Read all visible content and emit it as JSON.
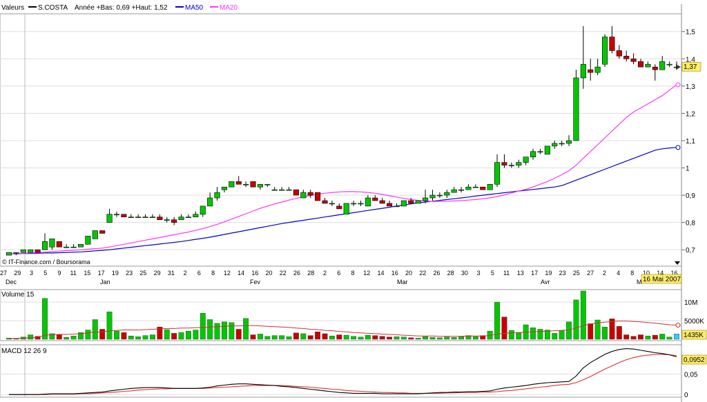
{
  "header": {
    "label_valeurs": "Valeurs",
    "ticker": "S.COSTA",
    "year_range": "Année +Bas: 0,69 +Haut: 1,52",
    "ma50_label": "MA50",
    "ma20_label": "MA20"
  },
  "colors": {
    "up": "#00c800",
    "down": "#c80000",
    "ma50": "#0000cc",
    "ma20": "#ff33ff",
    "volume_avg": "#cc3333",
    "macd": "#000000",
    "signal": "#dd3333",
    "label_bg": "#ffee66",
    "volume_last": "#33ccff"
  },
  "price_panel": {
    "y_ticks": [
      "1,5",
      "1,4",
      "1,3",
      "1,2",
      "1,1",
      "1",
      "0,9",
      "0,8",
      "0,7"
    ],
    "y_tick_values": [
      1.5,
      1.4,
      1.3,
      1.2,
      1.1,
      1.0,
      0.9,
      0.8,
      0.7
    ],
    "ylim": [
      0.66,
      1.56
    ],
    "last_price_label": "1,37",
    "last_price": 1.37,
    "date_tooltip": "16 Mai 2007",
    "credit": "© IT-Finance.com / Boursorama"
  },
  "x_axis": {
    "day_labels": [
      "27",
      "29",
      "3",
      "5",
      "9",
      "11",
      "15",
      "17",
      "19",
      "23",
      "25",
      "29",
      "31",
      "2",
      "6",
      "8",
      "12",
      "14",
      "16",
      "20",
      "22",
      "26",
      "28",
      "2",
      "6",
      "8",
      "12",
      "14",
      "16",
      "20",
      "22",
      "26",
      "28",
      "30",
      "3",
      "5",
      "11",
      "13",
      "17",
      "19",
      "23",
      "25",
      "27",
      "2",
      "4",
      "8",
      "10",
      "14",
      "16"
    ],
    "month_labels": [
      "Dec",
      "Jan",
      "Fev",
      "Mar",
      "Avr",
      "M"
    ],
    "month_label_days": [
      0,
      14,
      46,
      90,
      120,
      154
    ]
  },
  "volume_panel": {
    "title": "Volume 15",
    "y_ticks": [
      "10M",
      "5000K"
    ],
    "y_tick_values": [
      10000000,
      5000000
    ],
    "ymax": 13000000,
    "last_label": "1435K"
  },
  "macd_panel": {
    "title": "MACD 12 26 9",
    "y_ticks": [
      "0,05",
      "0"
    ],
    "y_tick_values": [
      0.05,
      0
    ],
    "ylim": [
      -0.003,
      0.118
    ],
    "last_label": "0,0952"
  },
  "chart_data": {
    "type": "candlestick",
    "title": "S.COSTA",
    "candles": [
      [
        0.68,
        0.69,
        0.68,
        0.69,
        300000
      ],
      [
        0.69,
        0.69,
        0.68,
        0.69,
        200000
      ],
      [
        0.69,
        0.7,
        0.69,
        0.7,
        600000
      ],
      [
        0.69,
        0.7,
        0.69,
        0.7,
        1200000
      ],
      [
        0.7,
        0.7,
        0.69,
        0.69,
        800000
      ],
      [
        0.7,
        0.76,
        0.7,
        0.73,
        11000000
      ],
      [
        0.71,
        0.74,
        0.7,
        0.74,
        1500000
      ],
      [
        0.73,
        0.73,
        0.71,
        0.71,
        1300000
      ],
      [
        0.71,
        0.72,
        0.71,
        0.71,
        500000
      ],
      [
        0.71,
        0.72,
        0.71,
        0.71,
        900000
      ],
      [
        0.71,
        0.72,
        0.71,
        0.72,
        1800000
      ],
      [
        0.72,
        0.75,
        0.72,
        0.75,
        2500000
      ],
      [
        0.74,
        0.77,
        0.74,
        0.77,
        5300000
      ],
      [
        0.77,
        0.77,
        0.76,
        0.76,
        2700000
      ],
      [
        0.8,
        0.85,
        0.8,
        0.83,
        7400000
      ],
      [
        0.83,
        0.84,
        0.82,
        0.83,
        2200000
      ],
      [
        0.83,
        0.83,
        0.82,
        0.82,
        1800000
      ],
      [
        0.82,
        0.83,
        0.82,
        0.82,
        900000
      ],
      [
        0.82,
        0.83,
        0.82,
        0.82,
        700000
      ],
      [
        0.82,
        0.83,
        0.82,
        0.82,
        1000000
      ],
      [
        0.82,
        0.83,
        0.82,
        0.82,
        1200000
      ],
      [
        0.82,
        0.83,
        0.81,
        0.81,
        3300000
      ],
      [
        0.81,
        0.82,
        0.8,
        0.81,
        2600000
      ],
      [
        0.81,
        0.82,
        0.79,
        0.8,
        1600000
      ],
      [
        0.81,
        0.83,
        0.81,
        0.82,
        1800000
      ],
      [
        0.82,
        0.83,
        0.82,
        0.82,
        2200000
      ],
      [
        0.82,
        0.84,
        0.82,
        0.83,
        2500000
      ],
      [
        0.83,
        0.86,
        0.82,
        0.86,
        7000000
      ],
      [
        0.86,
        0.91,
        0.86,
        0.89,
        5300000
      ],
      [
        0.89,
        0.93,
        0.88,
        0.91,
        4300000
      ],
      [
        0.92,
        0.93,
        0.91,
        0.93,
        4700000
      ],
      [
        0.93,
        0.95,
        0.93,
        0.95,
        4500000
      ],
      [
        0.95,
        0.97,
        0.94,
        0.94,
        2700000
      ],
      [
        0.94,
        0.95,
        0.93,
        0.94,
        5600000
      ],
      [
        0.95,
        0.95,
        0.93,
        0.93,
        1200000
      ],
      [
        0.93,
        0.94,
        0.92,
        0.94,
        1400000
      ],
      [
        0.94,
        0.94,
        0.93,
        0.94,
        800000
      ],
      [
        0.92,
        0.93,
        0.92,
        0.92,
        1000000
      ],
      [
        0.92,
        0.93,
        0.92,
        0.92,
        1000000
      ],
      [
        0.92,
        0.93,
        0.92,
        0.92,
        700000
      ],
      [
        0.92,
        0.92,
        0.9,
        0.9,
        1700000
      ],
      [
        0.89,
        0.92,
        0.89,
        0.91,
        1500000
      ],
      [
        0.91,
        0.92,
        0.89,
        0.9,
        1000000
      ],
      [
        0.91,
        0.91,
        0.88,
        0.88,
        2000000
      ],
      [
        0.88,
        0.89,
        0.87,
        0.87,
        1500000
      ],
      [
        0.87,
        0.88,
        0.86,
        0.87,
        900000
      ],
      [
        0.86,
        0.87,
        0.85,
        0.85,
        1200000
      ],
      [
        0.83,
        0.87,
        0.83,
        0.87,
        1100000
      ],
      [
        0.87,
        0.88,
        0.86,
        0.87,
        800000
      ],
      [
        0.87,
        0.88,
        0.86,
        0.87,
        600000
      ],
      [
        0.86,
        0.9,
        0.86,
        0.89,
        1100000
      ],
      [
        0.89,
        0.9,
        0.88,
        0.88,
        1000000
      ],
      [
        0.88,
        0.89,
        0.87,
        0.87,
        800000
      ],
      [
        0.87,
        0.88,
        0.86,
        0.86,
        600000
      ],
      [
        0.86,
        0.87,
        0.86,
        0.86,
        700000
      ],
      [
        0.86,
        0.88,
        0.86,
        0.88,
        600000
      ],
      [
        0.88,
        0.89,
        0.87,
        0.87,
        400000
      ],
      [
        0.87,
        0.88,
        0.87,
        0.88,
        300000
      ],
      [
        0.88,
        0.92,
        0.87,
        0.89,
        700000
      ],
      [
        0.89,
        0.92,
        0.88,
        0.9,
        500000
      ],
      [
        0.9,
        0.91,
        0.89,
        0.9,
        400000
      ],
      [
        0.9,
        0.92,
        0.89,
        0.91,
        600000
      ],
      [
        0.91,
        0.93,
        0.91,
        0.92,
        500000
      ],
      [
        0.92,
        0.93,
        0.91,
        0.92,
        700000
      ],
      [
        0.92,
        0.94,
        0.92,
        0.93,
        1000000
      ],
      [
        0.93,
        0.94,
        0.93,
        0.93,
        700000
      ],
      [
        0.93,
        0.93,
        0.92,
        0.92,
        1000000
      ],
      [
        0.92,
        0.94,
        0.92,
        0.94,
        2200000
      ],
      [
        0.94,
        1.05,
        0.93,
        1.02,
        10000000
      ],
      [
        1.02,
        1.05,
        1.0,
        1.01,
        6000000
      ],
      [
        1.01,
        1.02,
        1.0,
        1.01,
        2400000
      ],
      [
        1.01,
        1.03,
        1.0,
        1.02,
        1700000
      ],
      [
        1.02,
        1.04,
        1.01,
        1.04,
        3900000
      ],
      [
        1.04,
        1.07,
        1.03,
        1.06,
        3100000
      ],
      [
        1.06,
        1.07,
        1.05,
        1.06,
        2700000
      ],
      [
        1.05,
        1.08,
        1.05,
        1.08,
        2500000
      ],
      [
        1.08,
        1.1,
        1.07,
        1.09,
        1600000
      ],
      [
        1.09,
        1.1,
        1.08,
        1.09,
        2300000
      ],
      [
        1.09,
        1.12,
        1.08,
        1.1,
        4700000
      ],
      [
        1.1,
        1.36,
        1.1,
        1.33,
        10600000
      ],
      [
        1.33,
        1.52,
        1.29,
        1.38,
        13000000
      ],
      [
        1.36,
        1.4,
        1.32,
        1.35,
        4200000
      ],
      [
        1.35,
        1.4,
        1.34,
        1.37,
        5200000
      ],
      [
        1.38,
        1.49,
        1.37,
        1.48,
        3300000
      ],
      [
        1.48,
        1.52,
        1.42,
        1.43,
        5500000
      ],
      [
        1.43,
        1.45,
        1.4,
        1.41,
        3500000
      ],
      [
        1.41,
        1.43,
        1.39,
        1.4,
        1200000
      ],
      [
        1.4,
        1.42,
        1.38,
        1.39,
        800000
      ],
      [
        1.39,
        1.4,
        1.37,
        1.37,
        1200000
      ],
      [
        1.37,
        1.39,
        1.37,
        1.38,
        900000
      ],
      [
        1.37,
        1.38,
        1.32,
        1.36,
        1100000
      ],
      [
        1.36,
        1.41,
        1.36,
        1.39,
        1400000
      ],
      [
        1.38,
        1.39,
        1.37,
        1.38,
        600000
      ],
      [
        1.37,
        1.39,
        1.36,
        1.37,
        1435000
      ]
    ],
    "candle_fields": [
      "open",
      "high",
      "low",
      "close",
      "volume"
    ],
    "ma20": [
      0.685,
      0.686,
      0.687,
      0.688,
      0.689,
      0.691,
      0.693,
      0.695,
      0.697,
      0.698,
      0.7,
      0.702,
      0.704,
      0.706,
      0.71,
      0.715,
      0.72,
      0.725,
      0.73,
      0.735,
      0.74,
      0.745,
      0.75,
      0.755,
      0.76,
      0.765,
      0.771,
      0.777,
      0.785,
      0.793,
      0.802,
      0.812,
      0.822,
      0.832,
      0.842,
      0.852,
      0.86,
      0.868,
      0.875,
      0.882,
      0.888,
      0.894,
      0.899,
      0.904,
      0.907,
      0.91,
      0.912,
      0.913,
      0.913,
      0.912,
      0.91,
      0.907,
      0.903,
      0.898,
      0.893,
      0.888,
      0.884,
      0.881,
      0.879,
      0.877,
      0.877,
      0.878,
      0.879,
      0.88,
      0.882,
      0.884,
      0.887,
      0.89,
      0.895,
      0.901,
      0.908,
      0.915,
      0.922,
      0.93,
      0.94,
      0.95,
      0.962,
      0.975,
      0.99,
      1.01,
      1.035,
      1.06,
      1.085,
      1.11,
      1.135,
      1.16,
      1.185,
      1.205,
      1.22,
      1.235,
      1.25,
      1.265,
      1.285,
      1.305
    ],
    "ma50": [
      0.685,
      0.685,
      0.686,
      0.686,
      0.687,
      0.688,
      0.688,
      0.689,
      0.69,
      0.691,
      0.692,
      0.694,
      0.696,
      0.698,
      0.7,
      0.703,
      0.706,
      0.709,
      0.712,
      0.715,
      0.718,
      0.721,
      0.724,
      0.727,
      0.73,
      0.734,
      0.738,
      0.742,
      0.746,
      0.751,
      0.756,
      0.761,
      0.766,
      0.771,
      0.776,
      0.781,
      0.786,
      0.791,
      0.796,
      0.8,
      0.804,
      0.808,
      0.812,
      0.816,
      0.82,
      0.824,
      0.828,
      0.832,
      0.836,
      0.84,
      0.844,
      0.848,
      0.852,
      0.856,
      0.86,
      0.864,
      0.868,
      0.872,
      0.875,
      0.878,
      0.881,
      0.884,
      0.887,
      0.89,
      0.893,
      0.897,
      0.9,
      0.903,
      0.906,
      0.909,
      0.912,
      0.915,
      0.918,
      0.921,
      0.924,
      0.927,
      0.93,
      0.935,
      0.945,
      0.955,
      0.965,
      0.975,
      0.985,
      0.995,
      1.005,
      1.015,
      1.025,
      1.035,
      1.045,
      1.055,
      1.065,
      1.07,
      1.073,
      1.075
    ],
    "volume_avg": [
      200000,
      250000,
      300000,
      400000,
      500000,
      1100000,
      1200000,
      1300000,
      1300000,
      1400000,
      1500000,
      1700000,
      1900000,
      2000000,
      2300000,
      2400000,
      2500000,
      2500000,
      2500000,
      2600000,
      2700000,
      2800000,
      2900000,
      2900000,
      3000000,
      3000000,
      3100000,
      3200000,
      3300000,
      3400000,
      3500000,
      3600000,
      3600000,
      3700000,
      3700000,
      3600000,
      3500000,
      3400000,
      3300000,
      3200000,
      3000000,
      2900000,
      2700000,
      2600000,
      2400000,
      2300000,
      2100000,
      2000000,
      1800000,
      1700000,
      1600000,
      1500000,
      1400000,
      1300000,
      1200000,
      1100000,
      1000000,
      900000,
      900000,
      900000,
      800000,
      800000,
      800000,
      800000,
      900000,
      900000,
      900000,
      1000000,
      1400000,
      1600000,
      1700000,
      1800000,
      1900000,
      2000000,
      2100000,
      2200000,
      2300000,
      2400000,
      2500000,
      3000000,
      3700000,
      4100000,
      4400000,
      4600000,
      4800000,
      4900000,
      4900000,
      4800000,
      4700000,
      4500000,
      4300000,
      4100000,
      3900000,
      3800000
    ],
    "macd": [
      0.0,
      0.0,
      0.0,
      0.0,
      0.0,
      0.001,
      0.002,
      0.002,
      0.002,
      0.002,
      0.003,
      0.004,
      0.005,
      0.006,
      0.009,
      0.011,
      0.013,
      0.015,
      0.016,
      0.017,
      0.017,
      0.017,
      0.016,
      0.015,
      0.015,
      0.015,
      0.015,
      0.016,
      0.018,
      0.021,
      0.023,
      0.025,
      0.026,
      0.026,
      0.025,
      0.024,
      0.023,
      0.022,
      0.02,
      0.019,
      0.017,
      0.015,
      0.013,
      0.011,
      0.009,
      0.007,
      0.005,
      0.004,
      0.003,
      0.003,
      0.003,
      0.003,
      0.002,
      0.002,
      0.002,
      0.002,
      0.002,
      0.002,
      0.003,
      0.004,
      0.005,
      0.005,
      0.006,
      0.006,
      0.007,
      0.007,
      0.008,
      0.009,
      0.013,
      0.016,
      0.018,
      0.02,
      0.022,
      0.025,
      0.027,
      0.029,
      0.03,
      0.031,
      0.032,
      0.045,
      0.065,
      0.078,
      0.088,
      0.098,
      0.105,
      0.11,
      0.112,
      0.111,
      0.108,
      0.105,
      0.102,
      0.1,
      0.097,
      0.092
    ],
    "signal": [
      0.0,
      0.0,
      0.0,
      0.0,
      0.0,
      0.0,
      0.001,
      0.001,
      0.001,
      0.001,
      0.002,
      0.002,
      0.003,
      0.004,
      0.005,
      0.006,
      0.008,
      0.009,
      0.011,
      0.012,
      0.013,
      0.014,
      0.014,
      0.015,
      0.015,
      0.015,
      0.015,
      0.015,
      0.016,
      0.017,
      0.018,
      0.019,
      0.02,
      0.021,
      0.022,
      0.022,
      0.022,
      0.022,
      0.022,
      0.021,
      0.02,
      0.019,
      0.018,
      0.016,
      0.015,
      0.013,
      0.012,
      0.01,
      0.009,
      0.008,
      0.007,
      0.006,
      0.005,
      0.005,
      0.004,
      0.004,
      0.003,
      0.003,
      0.003,
      0.003,
      0.003,
      0.004,
      0.004,
      0.005,
      0.005,
      0.005,
      0.006,
      0.006,
      0.007,
      0.009,
      0.01,
      0.012,
      0.014,
      0.016,
      0.018,
      0.02,
      0.022,
      0.024,
      0.025,
      0.029,
      0.036,
      0.044,
      0.053,
      0.062,
      0.07,
      0.078,
      0.085,
      0.09,
      0.094,
      0.096,
      0.098,
      0.098,
      0.097,
      0.095
    ]
  }
}
